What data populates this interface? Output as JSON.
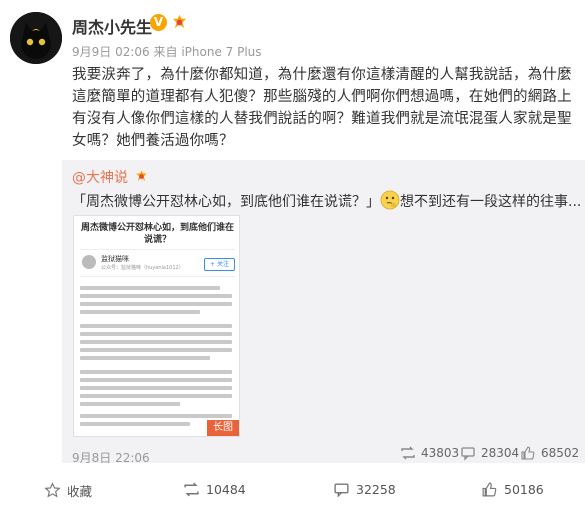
{
  "user": {
    "name": "周杰小先生",
    "verified_mark": "V",
    "post_time": "9月9日 02:06",
    "source": "来自 iPhone 7 Plus"
  },
  "post": {
    "text": "我要涙奔了，為什麼你都知道，為什麼還有你這樣清醒的人幫我說話，為什麼這麼簡單的道理都有人犯傻？那些腦殘的人們啊你們想過嗎，在她們的網路上有沒有人像你們這樣的人替我們說話的啊？難道我們就是流氓混蛋人家就是聖女嗎？她們養活過你嗎？"
  },
  "repost": {
    "author": "@大神说",
    "text_before_emoji": "「周杰微博公开怼林心如，到底他们谁在说谎？」",
    "text_after_emoji": "想不到还有一段这样的往事...",
    "emoji_name": "thinking-emoji",
    "image": {
      "title": "周杰微博公开怼林心如，到底他们谁在说谎？",
      "account_name": "监狱猫咪",
      "account_sub": "公众号：监狱猫咪（huyanla1012）",
      "follow_label": "+ 关注",
      "tag": "长图"
    },
    "date": "9月8日 22:06",
    "stats": {
      "reposts": "43803",
      "comments": "28304",
      "likes": "68502"
    }
  },
  "actions": {
    "favorite_label": "收藏",
    "reposts": "10484",
    "comments": "32258",
    "likes": "50186"
  },
  "colors": {
    "link": "#eb7350",
    "verified_badge": "#f7a600",
    "repost_bg": "#f2f2f5",
    "long_image_tag": "#e8623a"
  }
}
